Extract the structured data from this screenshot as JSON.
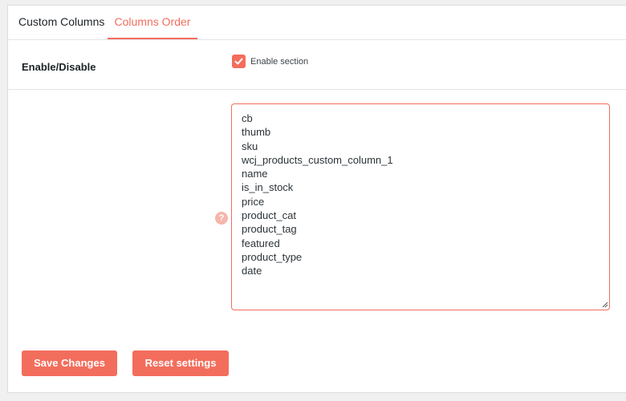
{
  "tabs": [
    {
      "label": "Custom Columns",
      "active": false
    },
    {
      "label": "Columns Order",
      "active": true
    }
  ],
  "enable_row": {
    "label": "Enable/Disable",
    "checkbox_label": "Enable section",
    "checked": true
  },
  "order_field": {
    "help_icon": "help-icon",
    "value": "cb\nthumb\nsku\nwcj_products_custom_column_1\nname\nis_in_stock\nprice\nproduct_cat\nproduct_tag\nfeatured\nproduct_type\ndate"
  },
  "buttons": {
    "save_label": "Save Changes",
    "reset_label": "Reset settings"
  },
  "colors": {
    "accent": "#f36d5c",
    "help_icon": "#f6b6ab",
    "background": "#f0f0f1",
    "panel": "#ffffff"
  }
}
